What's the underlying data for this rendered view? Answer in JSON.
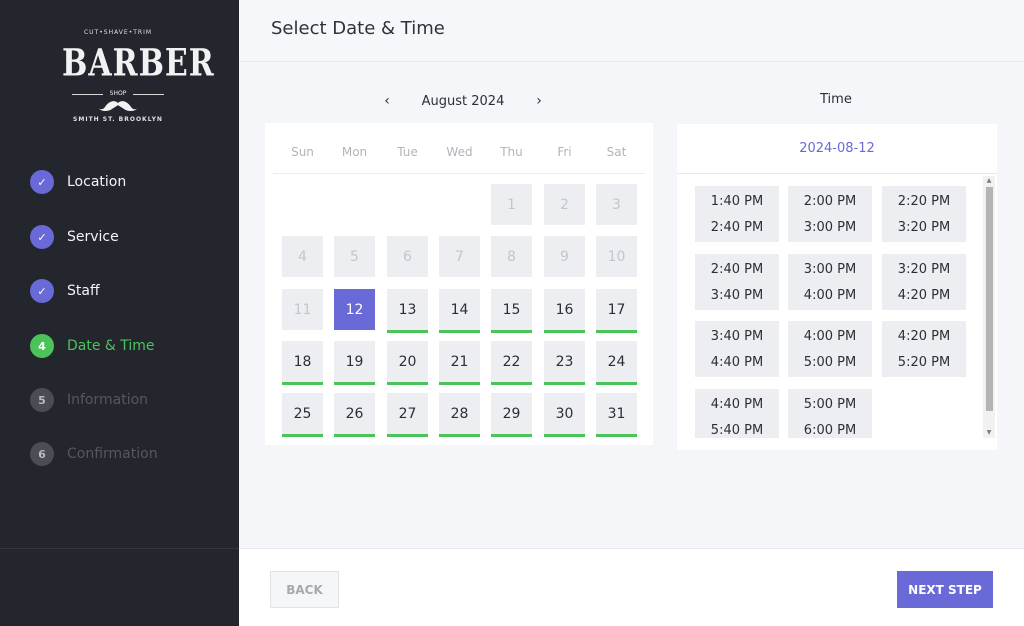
{
  "brand": {
    "arc_top": "CUT•SHAVE•TRIM",
    "name": "BARBER",
    "sub": "SHOP",
    "arc_bottom": "SMITH ST. BROOKLYN"
  },
  "steps": [
    {
      "label": "Location",
      "badge": "✓",
      "state": "done"
    },
    {
      "label": "Service",
      "badge": "✓",
      "state": "done"
    },
    {
      "label": "Staff",
      "badge": "✓",
      "state": "done"
    },
    {
      "label": "Date & Time",
      "badge": "4",
      "state": "active"
    },
    {
      "label": "Information",
      "badge": "5",
      "state": "todo"
    },
    {
      "label": "Confirmation",
      "badge": "6",
      "state": "todo"
    }
  ],
  "header": {
    "title": "Select Date & Time"
  },
  "calendar": {
    "prev": "‹",
    "next": "›",
    "month_label": "August 2024",
    "weekdays": [
      "Sun",
      "Mon",
      "Tue",
      "Wed",
      "Thu",
      "Fri",
      "Sat"
    ],
    "days": [
      {
        "d": "1",
        "state": "disabled"
      },
      {
        "d": "2",
        "state": "disabled"
      },
      {
        "d": "3",
        "state": "disabled"
      },
      {
        "d": "4",
        "state": "disabled"
      },
      {
        "d": "5",
        "state": "disabled"
      },
      {
        "d": "6",
        "state": "disabled"
      },
      {
        "d": "7",
        "state": "disabled"
      },
      {
        "d": "8",
        "state": "disabled"
      },
      {
        "d": "9",
        "state": "disabled"
      },
      {
        "d": "10",
        "state": "disabled"
      },
      {
        "d": "11",
        "state": "disabled"
      },
      {
        "d": "12",
        "state": "selected"
      },
      {
        "d": "13",
        "state": "avail"
      },
      {
        "d": "14",
        "state": "avail"
      },
      {
        "d": "15",
        "state": "avail"
      },
      {
        "d": "16",
        "state": "avail"
      },
      {
        "d": "17",
        "state": "avail"
      },
      {
        "d": "18",
        "state": "avail"
      },
      {
        "d": "19",
        "state": "avail"
      },
      {
        "d": "20",
        "state": "avail"
      },
      {
        "d": "21",
        "state": "avail"
      },
      {
        "d": "22",
        "state": "avail"
      },
      {
        "d": "23",
        "state": "avail"
      },
      {
        "d": "24",
        "state": "avail"
      },
      {
        "d": "25",
        "state": "avail"
      },
      {
        "d": "26",
        "state": "avail"
      },
      {
        "d": "27",
        "state": "avail"
      },
      {
        "d": "28",
        "state": "avail"
      },
      {
        "d": "29",
        "state": "avail"
      },
      {
        "d": "30",
        "state": "avail"
      },
      {
        "d": "31",
        "state": "avail"
      }
    ],
    "first_weekday_index": 4
  },
  "time": {
    "heading": "Time",
    "selected_date": "2024-08-12",
    "slots": [
      {
        "start": "1:40 PM",
        "end": "2:40 PM"
      },
      {
        "start": "2:00 PM",
        "end": "3:00 PM"
      },
      {
        "start": "2:20 PM",
        "end": "3:20 PM"
      },
      {
        "start": "2:40 PM",
        "end": "3:40 PM"
      },
      {
        "start": "3:00 PM",
        "end": "4:00 PM"
      },
      {
        "start": "3:20 PM",
        "end": "4:20 PM"
      },
      {
        "start": "3:40 PM",
        "end": "4:40 PM"
      },
      {
        "start": "4:00 PM",
        "end": "5:00 PM"
      },
      {
        "start": "4:20 PM",
        "end": "5:20 PM"
      },
      {
        "start": "4:40 PM",
        "end": "5:40 PM"
      },
      {
        "start": "5:00 PM",
        "end": "6:00 PM"
      }
    ]
  },
  "footer": {
    "back_label": "BACK",
    "next_label": "NEXT STEP"
  },
  "colors": {
    "accent": "#6a69d8",
    "success": "#4cc35a",
    "sidebar": "#23262d"
  }
}
